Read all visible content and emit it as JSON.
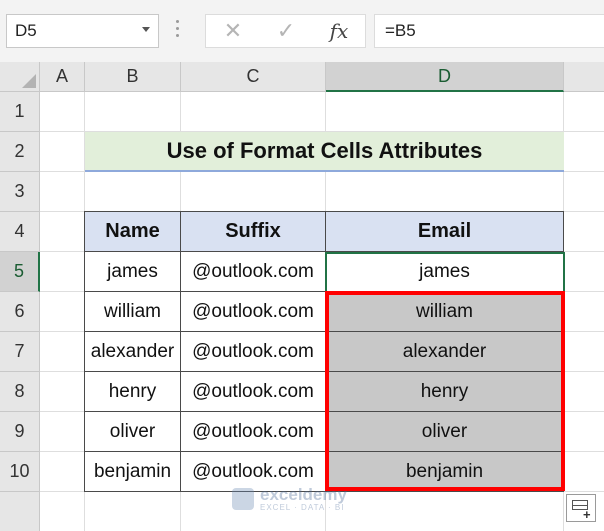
{
  "formula_bar": {
    "name_box": "D5",
    "cancel_icon": "✕",
    "enter_icon": "✓",
    "fx_label": "fx",
    "formula": "=B5"
  },
  "columns": [
    "A",
    "B",
    "C",
    "D"
  ],
  "rows": [
    "1",
    "2",
    "3",
    "4",
    "5",
    "6",
    "7",
    "8",
    "9",
    "10"
  ],
  "title": "Use of Format Cells Attributes",
  "table": {
    "headers": [
      "Name",
      "Suffix",
      "Email"
    ],
    "rows": [
      [
        "james",
        "@outlook.com",
        "james"
      ],
      [
        "william",
        "@outlook.com",
        "william"
      ],
      [
        "alexander",
        "@outlook.com",
        "alexander"
      ],
      [
        "henry",
        "@outlook.com",
        "henry"
      ],
      [
        "oliver",
        "@outlook.com",
        "oliver"
      ],
      [
        "benjamin",
        "@outlook.com",
        "benjamin"
      ]
    ]
  },
  "watermark": {
    "name": "exceldemy",
    "tagline": "EXCEL · DATA · BI"
  },
  "colors": {
    "selection_green": "#217346",
    "highlight_red": "#ff0000",
    "header_fill": "#d9e1f2",
    "title_fill": "#e2efda",
    "gray_fill": "#c8c8c8"
  },
  "icons": [
    "chevron-down-icon",
    "cancel-icon",
    "enter-icon",
    "function-icon",
    "quick-analysis-icon"
  ]
}
